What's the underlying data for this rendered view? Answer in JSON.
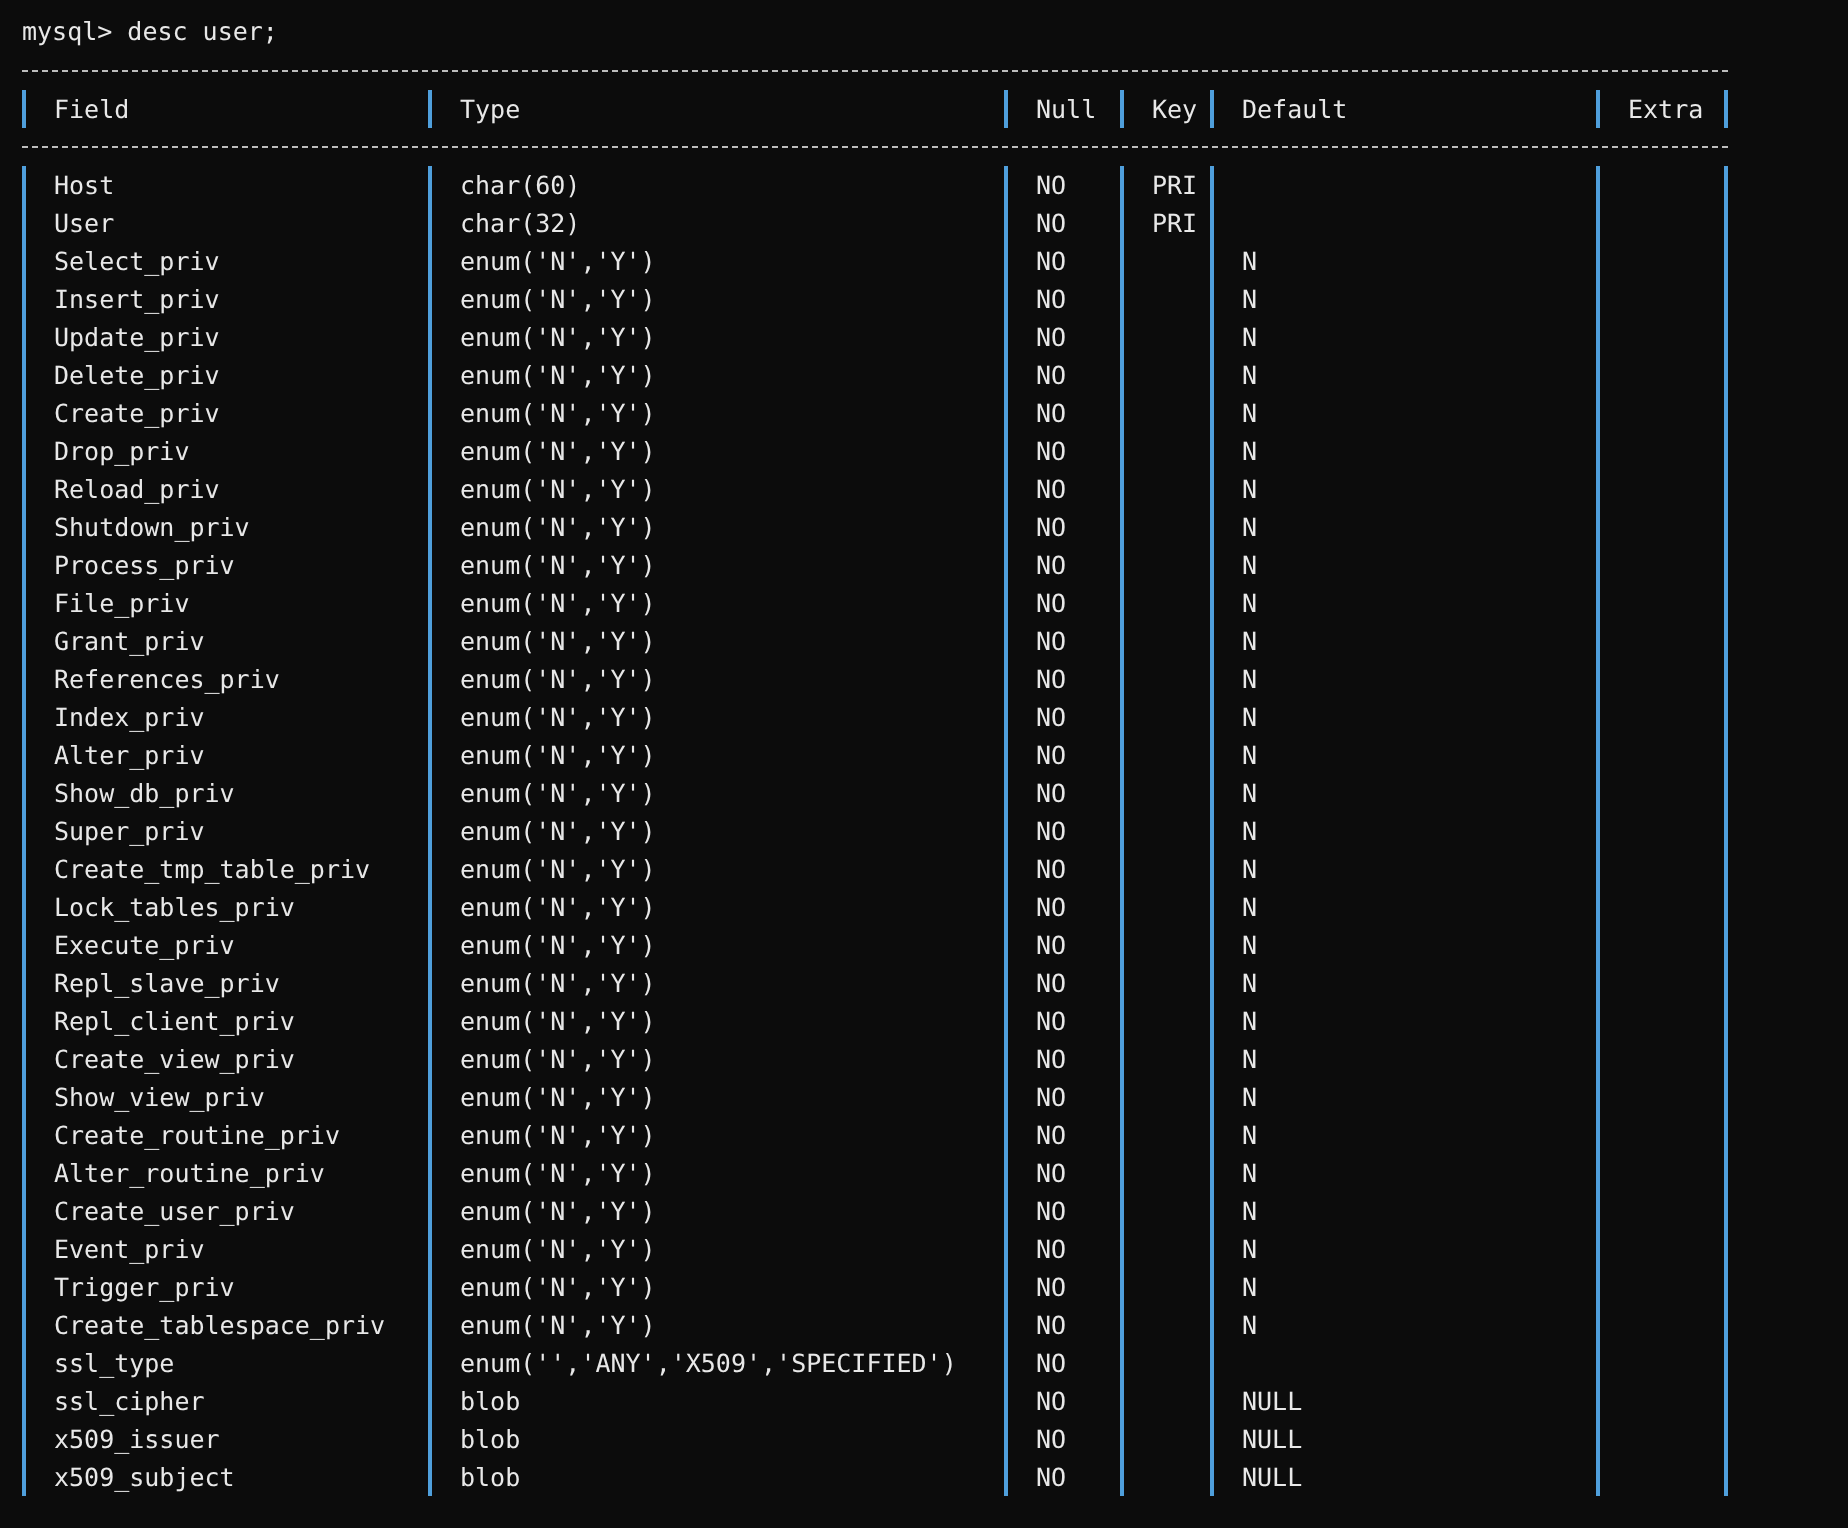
{
  "terminal": {
    "command": "mysql> desc user;",
    "table": {
      "columns": [
        "Field",
        "Type",
        "Null",
        "Key",
        "Default",
        "Extra"
      ],
      "rows": [
        {
          "field": "Host",
          "type": "char(60)",
          "null": "NO",
          "key": "PRI"
        },
        {
          "field": "User",
          "type": "char(32)",
          "null": "NO",
          "key": "PRI"
        },
        {
          "field": "Select_priv",
          "type": "enum('N','Y')",
          "null": "NO",
          "default": "N"
        },
        {
          "field": "Insert_priv",
          "type": "enum('N','Y')",
          "null": "NO",
          "default": "N"
        },
        {
          "field": "Update_priv",
          "type": "enum('N','Y')",
          "null": "NO",
          "default": "N"
        },
        {
          "field": "Delete_priv",
          "type": "enum('N','Y')",
          "null": "NO",
          "default": "N"
        },
        {
          "field": "Create_priv",
          "type": "enum('N','Y')",
          "null": "NO",
          "default": "N"
        },
        {
          "field": "Drop_priv",
          "type": "enum('N','Y')",
          "null": "NO",
          "default": "N"
        },
        {
          "field": "Reload_priv",
          "type": "enum('N','Y')",
          "null": "NO",
          "default": "N"
        },
        {
          "field": "Shutdown_priv",
          "type": "enum('N','Y')",
          "null": "NO",
          "default": "N"
        },
        {
          "field": "Process_priv",
          "type": "enum('N','Y')",
          "null": "NO",
          "default": "N"
        },
        {
          "field": "File_priv",
          "type": "enum('N','Y')",
          "null": "NO",
          "default": "N"
        },
        {
          "field": "Grant_priv",
          "type": "enum('N','Y')",
          "null": "NO",
          "default": "N"
        },
        {
          "field": "References_priv",
          "type": "enum('N','Y')",
          "null": "NO",
          "default": "N"
        },
        {
          "field": "Index_priv",
          "type": "enum('N','Y')",
          "null": "NO",
          "default": "N"
        },
        {
          "field": "Alter_priv",
          "type": "enum('N','Y')",
          "null": "NO",
          "default": "N"
        },
        {
          "field": "Show_db_priv",
          "type": "enum('N','Y')",
          "null": "NO",
          "default": "N"
        },
        {
          "field": "Super_priv",
          "type": "enum('N','Y')",
          "null": "NO",
          "default": "N"
        },
        {
          "field": "Create_tmp_table_priv",
          "type": "enum('N','Y')",
          "null": "NO",
          "default": "N"
        },
        {
          "field": "Lock_tables_priv",
          "type": "enum('N','Y')",
          "null": "NO",
          "default": "N"
        },
        {
          "field": "Execute_priv",
          "type": "enum('N','Y')",
          "null": "NO",
          "default": "N"
        },
        {
          "field": "Repl_slave_priv",
          "type": "enum('N','Y')",
          "null": "NO",
          "default": "N"
        },
        {
          "field": "Repl_client_priv",
          "type": "enum('N','Y')",
          "null": "NO",
          "default": "N"
        },
        {
          "field": "Create_view_priv",
          "type": "enum('N','Y')",
          "null": "NO",
          "default": "N"
        },
        {
          "field": "Show_view_priv",
          "type": "enum('N','Y')",
          "null": "NO",
          "default": "N"
        },
        {
          "field": "Create_routine_priv",
          "type": "enum('N','Y')",
          "null": "NO",
          "default": "N"
        },
        {
          "field": "Alter_routine_priv",
          "type": "enum('N','Y')",
          "null": "NO",
          "default": "N"
        },
        {
          "field": "Create_user_priv",
          "type": "enum('N','Y')",
          "null": "NO",
          "default": "N"
        },
        {
          "field": "Event_priv",
          "type": "enum('N','Y')",
          "null": "NO",
          "default": "N"
        },
        {
          "field": "Trigger_priv",
          "type": "enum('N','Y')",
          "null": "NO",
          "default": "N"
        },
        {
          "field": "Create_tablespace_priv",
          "type": "enum('N','Y')",
          "null": "NO",
          "default": "N"
        },
        {
          "field": "ssl_type",
          "type": "enum('','ANY','X509','SPECIFIED')",
          "null": "NO"
        },
        {
          "field": "ssl_cipher",
          "type": "blob",
          "null": "NO",
          "default": "NULL"
        },
        {
          "field": "x509_issuer",
          "type": "blob",
          "null": "NO",
          "default": "NULL"
        },
        {
          "field": "x509_subject",
          "type": "blob",
          "null": "NO",
          "default": "NULL"
        }
      ]
    }
  }
}
